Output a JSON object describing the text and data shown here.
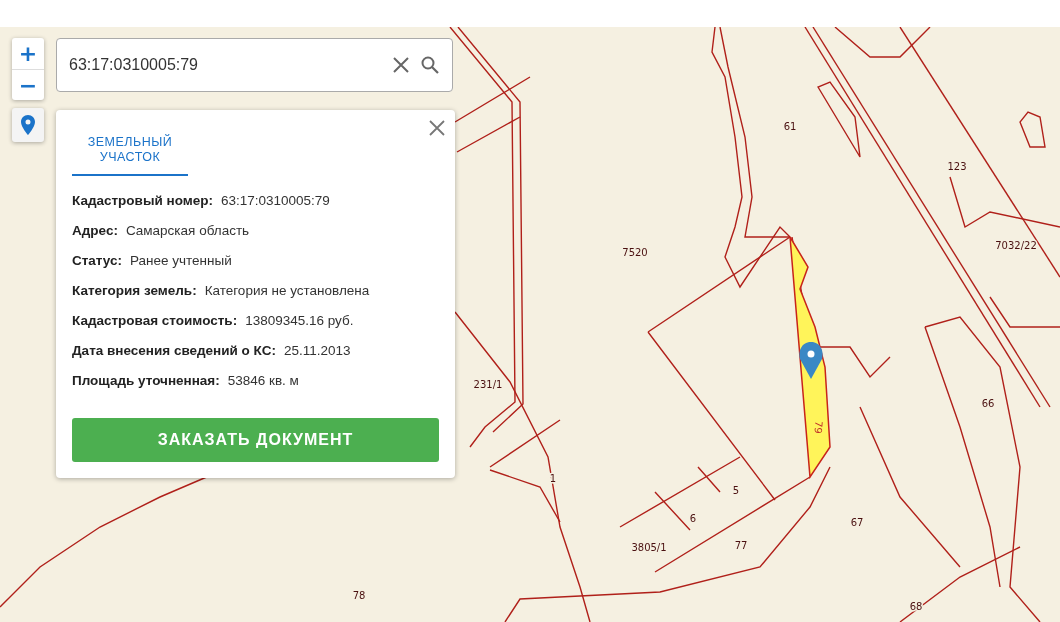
{
  "zoom": {
    "in_label": "+",
    "out_label": "−"
  },
  "search": {
    "value": "63:17:0310005:79"
  },
  "panel": {
    "tabs": [
      {
        "label": "ЗЕМЕЛЬНЫЙ УЧАСТОК",
        "selected": true
      }
    ],
    "fields": [
      {
        "label": "Кадастровый номер:",
        "value": "63:17:0310005:79"
      },
      {
        "label": "Адрес:",
        "value": "Самарская область"
      },
      {
        "label": "Статус:",
        "value": "Ранее учтенный"
      },
      {
        "label": "Категория земель:",
        "value": "Категория не установлена"
      },
      {
        "label": "Кадастровая стоимость:",
        "value": "13809345.16 руб."
      },
      {
        "label": "Дата внесения сведений о КС:",
        "value": "25.11.2013"
      },
      {
        "label": "Площадь уточненная:",
        "value": "53846 кв. м"
      }
    ],
    "button": "ЗАКАЗАТЬ ДОКУМЕНТ"
  },
  "map": {
    "selected_parcel_label": "79",
    "parcel_labels": [
      "61",
      "7520",
      "123",
      "7032/22",
      "231/1",
      "1",
      "5",
      "6",
      "3805/1",
      "77",
      "67",
      "66",
      "78",
      "68"
    ]
  }
}
